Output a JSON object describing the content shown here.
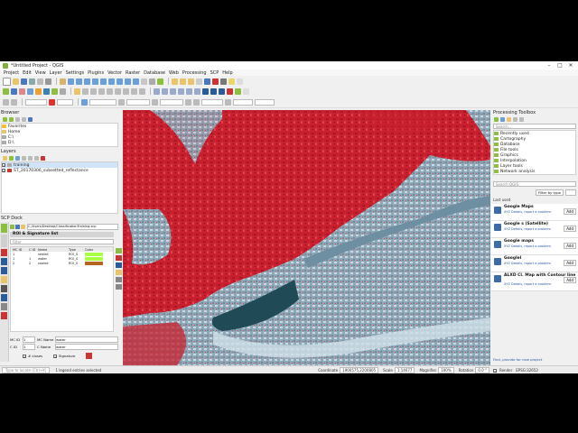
{
  "window": {
    "title": "*Untitled Project - QGIS"
  },
  "menu": [
    "Project",
    "Edit",
    "View",
    "Layer",
    "Settings",
    "Plugins",
    "Vector",
    "Raster",
    "Database",
    "Web",
    "Processing",
    "SCP",
    "Help"
  ],
  "browser": {
    "title": "Browser",
    "items": [
      "Favorites",
      "Home",
      "C:\\",
      "D:\\"
    ]
  },
  "layers": {
    "title": "Layers",
    "items": [
      {
        "label": "training"
      },
      {
        "label": "ST_20170306_subsetted_reflectance"
      }
    ]
  },
  "scp": {
    "title": "SCP Dock",
    "path": "C:/Users/Desktop/ClassificationTraining.scp",
    "section": "ROI & Signature list",
    "filter": "Filter",
    "table_headers": [
      "MC ID",
      "C ID",
      "Name",
      "Type",
      "Color"
    ],
    "rows": [
      {
        "mcid": "1",
        "cid": "",
        "name": "sealed",
        "type": "ROI_S"
      },
      {
        "mcid": "1",
        "cid": "1",
        "name": "water",
        "type": "ROI_S"
      },
      {
        "mcid": "2",
        "cid": "2",
        "name": "sealed",
        "type": "ROI_S"
      }
    ],
    "mc_id_label": "MC ID",
    "mc_id_value": "1",
    "mc_name_label": "MC Name",
    "mc_name_value": "water",
    "c_id_label": "C ID",
    "c_id_value": "1",
    "c_name_label": "C Name",
    "c_name_value": "water",
    "check_display": "# closes",
    "check_signature": "Signature"
  },
  "processing": {
    "title": "Processing Toolbox",
    "search_placeholder": "Search...",
    "groups": [
      "Recently used",
      "Cartography",
      "Database",
      "File tools",
      "Graphics",
      "Interpolation",
      "Layer tools",
      "Network analysis"
    ]
  },
  "plugins": {
    "search_placeholder": "Search QGIS",
    "filter_label": "Filter by type",
    "last_used": "Last used",
    "items": [
      {
        "name": "Google Maps",
        "sub": "XYZ Details, report a problem",
        "add": "Add"
      },
      {
        "name": "Google s (Satellite)",
        "sub": "XYZ Details, report a problem",
        "add": "Add"
      },
      {
        "name": "Google maps",
        "sub": "XYZ Details, report a problem",
        "add": "Add"
      },
      {
        "name": "Googlel",
        "sub": "XYZ Details, report a problem",
        "add": "Add"
      },
      {
        "name": "ALXD Cl. Map with Contour line",
        "sub": "XYZ Details, report a problem",
        "add": "Add"
      }
    ],
    "footer": "Find, provide for new project"
  },
  "status": {
    "locator": "Type to locate (Ctrl+K)",
    "message": "1 legend entries selected",
    "coordinate_label": "Coordinate",
    "coordinate": "1900575,2200805",
    "scale_label": "Scale",
    "scale": "1:14677",
    "magnifier_label": "Magnifier",
    "magnifier": "100%",
    "rotation_label": "Rotation",
    "rotation": "0.0 °",
    "render_label": "Render",
    "crs": "EPSG:32652"
  },
  "colors": {
    "accent": "#7fb13a",
    "roi_water": "#aaff44",
    "roi_sealed": "#b5651d"
  }
}
